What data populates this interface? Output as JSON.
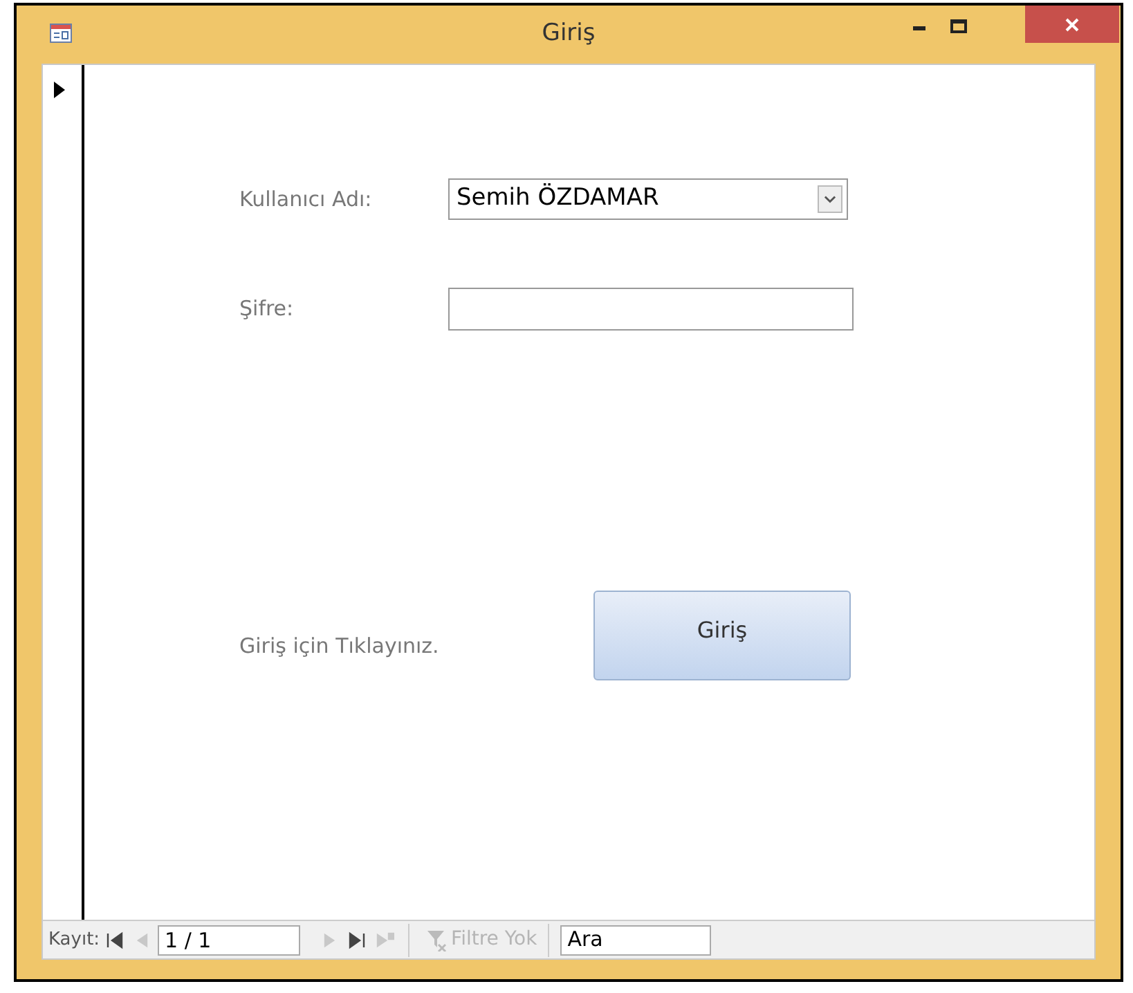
{
  "window": {
    "title": "Giriş"
  },
  "form": {
    "username_label": "Kullanıcı Adı:",
    "username_value": "Semih ÖZDAMAR",
    "password_label": "Şifre:",
    "hint": "Giriş için Tıklayınız.",
    "login_button": "Giriş"
  },
  "navigation": {
    "label": "Kayıt:",
    "record": "1 / 1",
    "buttons": [
      {
        "kind": "first",
        "disabled": false
      },
      {
        "kind": "previous",
        "disabled": true
      },
      {
        "kind": "next",
        "disabled": true
      },
      {
        "kind": "last",
        "disabled": false
      },
      {
        "kind": "new",
        "disabled": true
      }
    ],
    "filter": {
      "label": "Filtre Yok",
      "disabled": true
    },
    "search": {
      "value": "Ara"
    }
  }
}
